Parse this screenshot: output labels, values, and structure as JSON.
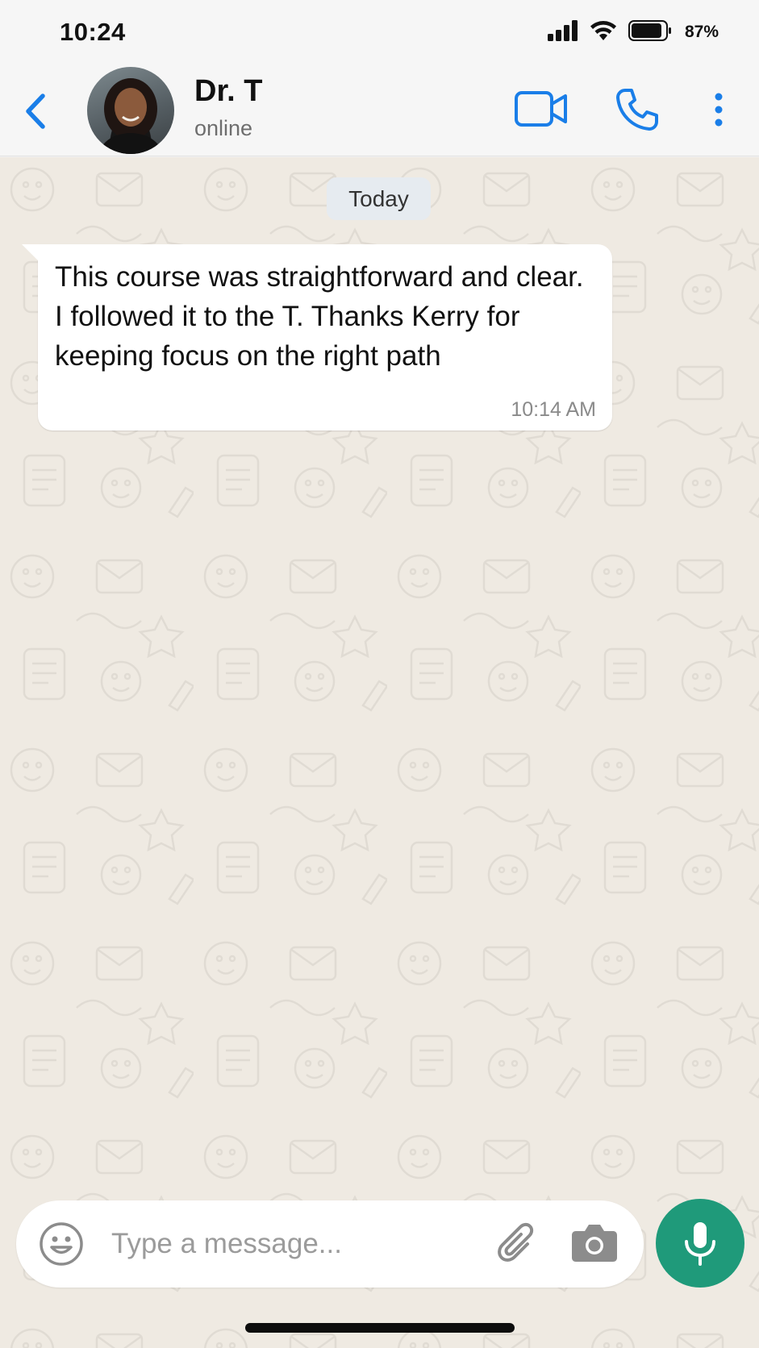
{
  "status_bar": {
    "time": "10:24",
    "battery_percent": "87%",
    "icons": [
      "signal-icon",
      "wifi-icon",
      "battery-icon"
    ]
  },
  "header": {
    "contact_name": "Dr. T",
    "contact_status": "online",
    "icons": [
      "back-chevron-icon",
      "video-call-icon",
      "phone-icon",
      "more-vertical-icon"
    ],
    "accent_color": "#1a7ee8"
  },
  "chat": {
    "date_label": "Today",
    "messages": [
      {
        "direction": "incoming",
        "text": "This course was straightforward and clear. I followed it to the T. Thanks Kerry for keeping focus on the right path",
        "time": "10:14 AM"
      }
    ],
    "wallpaper_color": "#efeae2"
  },
  "input_bar": {
    "placeholder": "Type a message...",
    "value": "",
    "icons": [
      "emoji-icon",
      "paperclip-icon",
      "camera-icon",
      "microphone-icon"
    ],
    "mic_button_color": "#1f9a7a"
  }
}
